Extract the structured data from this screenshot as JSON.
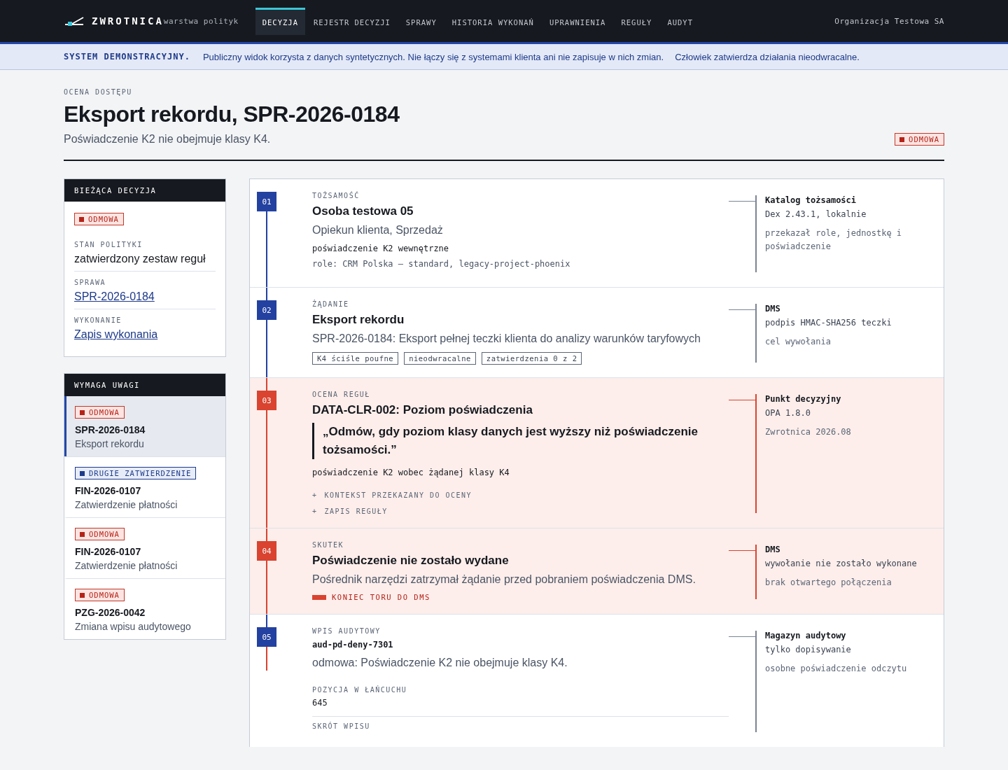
{
  "header": {
    "brand": "ZWROTNICA",
    "tagline": "warstwa polityk",
    "nav": [
      {
        "label": "DECYZJA",
        "selected": true
      },
      {
        "label": "REJESTR DECYZJI",
        "selected": false
      },
      {
        "label": "SPRAWY",
        "selected": false
      },
      {
        "label": "HISTORIA WYKONAŃ",
        "selected": false
      },
      {
        "label": "UPRAWNIENIA",
        "selected": false
      },
      {
        "label": "REGUŁY",
        "selected": false
      },
      {
        "label": "AUDYT",
        "selected": false
      }
    ],
    "organization": "Organizacja Testowa SA"
  },
  "banner": {
    "title": "SYSTEM DEMONSTRACYJNY.",
    "messages": [
      "Publiczny widok korzysta z danych syntetycznych. Nie łączy się z systemami klienta ani nie zapisuje w nich zmian.",
      "Człowiek zatwierdza działania nieodwracalne."
    ]
  },
  "page": {
    "eyebrow": "OCENA DOSTĘPU",
    "title": "Eksport rekordu, SPR-2026-0184",
    "subtitle": "Poświadczenie K2 nie obejmuje klasy K4.",
    "badge": {
      "kind": "deny",
      "text": "ODMOWA"
    }
  },
  "current_decision": {
    "heading": "BIEŻĄCA DECYZJA",
    "badge": {
      "kind": "deny",
      "text": "ODMOWA"
    },
    "fields": [
      {
        "label": "STAN POLITYKI",
        "value": "zatwierdzony zestaw reguł",
        "kind": "text"
      },
      {
        "label": "SPRAWA",
        "value": "SPR-2026-0184",
        "kind": "link"
      },
      {
        "label": "WYKONANIE",
        "value": "Zapis wykonania",
        "kind": "link"
      }
    ]
  },
  "attention": {
    "heading": "WYMAGA UWAGI",
    "items": [
      {
        "badge": {
          "kind": "deny",
          "text": "ODMOWA"
        },
        "id": "SPR-2026-0184",
        "title": "Eksport rekordu",
        "selected": true
      },
      {
        "badge": {
          "kind": "approval",
          "text": "DRUGIE ZATWIERDZENIE"
        },
        "id": "FIN-2026-0107",
        "title": "Zatwierdzenie płatności",
        "selected": false
      },
      {
        "badge": {
          "kind": "deny",
          "text": "ODMOWA"
        },
        "id": "FIN-2026-0107",
        "title": "Zatwierdzenie płatności",
        "selected": false
      },
      {
        "badge": {
          "kind": "deny",
          "text": "ODMOWA"
        },
        "id": "PZG-2026-0042",
        "title": "Zmiana wpisu audytowego",
        "selected": false
      }
    ]
  },
  "steps": [
    {
      "number": "01",
      "denied": false,
      "label": "TOŻSAMOŚĆ",
      "title": "Osoba testowa 05",
      "blocks": [
        {
          "kind": "sub",
          "text": "Opiekun klienta, Sprzedaż"
        },
        {
          "kind": "mono",
          "text": "poświadczenie K2 wewnętrzne"
        },
        {
          "kind": "mono_muted",
          "text": "role: CRM Polska – standard, legacy-project-phoenix"
        }
      ],
      "side": {
        "title": "Katalog tożsamości",
        "value": "Dex 2.43.1, lokalnie",
        "note": "przekazał role, jednostkę i poświadczenie"
      }
    },
    {
      "number": "02",
      "denied": false,
      "label": "ŻĄDANIE",
      "title": "Eksport rekordu",
      "blocks": [
        {
          "kind": "sub",
          "text": "SPR-2026-0184: Eksport pełnej teczki klienta do analizy warunków taryfowych"
        },
        {
          "kind": "tags",
          "items": [
            "K4 ściśle poufne",
            "nieodwracalne",
            "zatwierdzenia 0 z 2"
          ]
        }
      ],
      "side": {
        "title": "DMS",
        "value": "podpis HMAC-SHA256 teczki",
        "note": "cel wywołania"
      }
    },
    {
      "number": "03",
      "denied": true,
      "label": "OCENA REGUŁ",
      "title": "DATA-CLR-002: Poziom poświadczenia",
      "blocks": [
        {
          "kind": "quote",
          "text": "„Odmów, gdy poziom klasy danych jest wyższy niż poświadczenie tożsamości.”"
        },
        {
          "kind": "mono",
          "text": "poświadczenie K2 wobec żądanej klasy K4"
        },
        {
          "kind": "expander",
          "icon": "+",
          "text": "KONTEKST PRZEKAZANY DO OCENY"
        },
        {
          "kind": "expander",
          "icon": "+",
          "text": "ZAPIS REGUŁY"
        }
      ],
      "side": {
        "title": "Punkt decyzyjny",
        "value": "OPA 1.8.0",
        "note": "Zwrotnica 2026.08"
      }
    },
    {
      "number": "04",
      "denied": true,
      "label": "SKUTEK",
      "title": "Poświadczenie nie zostało wydane",
      "blocks": [
        {
          "kind": "sub",
          "text": "Pośrednik narzędzi zatrzymał żądanie przed pobraniem poświadczenia DMS."
        },
        {
          "kind": "end",
          "text": "KONIEC TORU DO DMS"
        }
      ],
      "side": {
        "title": "DMS",
        "value": "wywołanie nie zostało wykonane",
        "note": "brak otwartego połączenia"
      }
    },
    {
      "number": "05",
      "denied": false,
      "label": "WPIS AUDYTOWY",
      "blocks": [
        {
          "kind": "mono_bold",
          "text": "aud-pd-deny-7301"
        },
        {
          "kind": "sub",
          "text": "odmowa: Poświadczenie K2 nie obejmuje klasy K4."
        },
        {
          "kind": "field",
          "label": "POZYCJA W ŁAŃCUCHU",
          "value": "645"
        },
        {
          "kind": "field",
          "label": "SKRÓT WPISU"
        }
      ],
      "side": {
        "title": "Magazyn audytowy",
        "value": "tylko dopisywanie",
        "note": "osobne poświadczenie odczytu"
      }
    }
  ]
}
